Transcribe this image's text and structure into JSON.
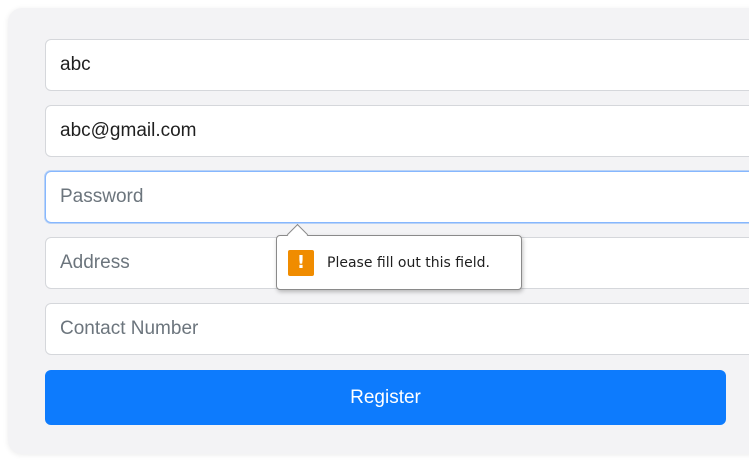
{
  "form": {
    "name": {
      "value": "abc",
      "placeholder": ""
    },
    "email": {
      "value": "abc@gmail.com",
      "placeholder": ""
    },
    "password": {
      "value": "",
      "placeholder": "Password"
    },
    "address": {
      "value": "",
      "placeholder": "Address"
    },
    "contact": {
      "value": "",
      "placeholder": "Contact Number"
    },
    "register_label": "Register"
  },
  "validation": {
    "icon": "warning-icon",
    "icon_glyph": "!",
    "message": "Please fill out this field."
  },
  "colors": {
    "primary": "#0d7bfd",
    "warning": "#f08c00",
    "card_bg": "#f3f3f5"
  }
}
